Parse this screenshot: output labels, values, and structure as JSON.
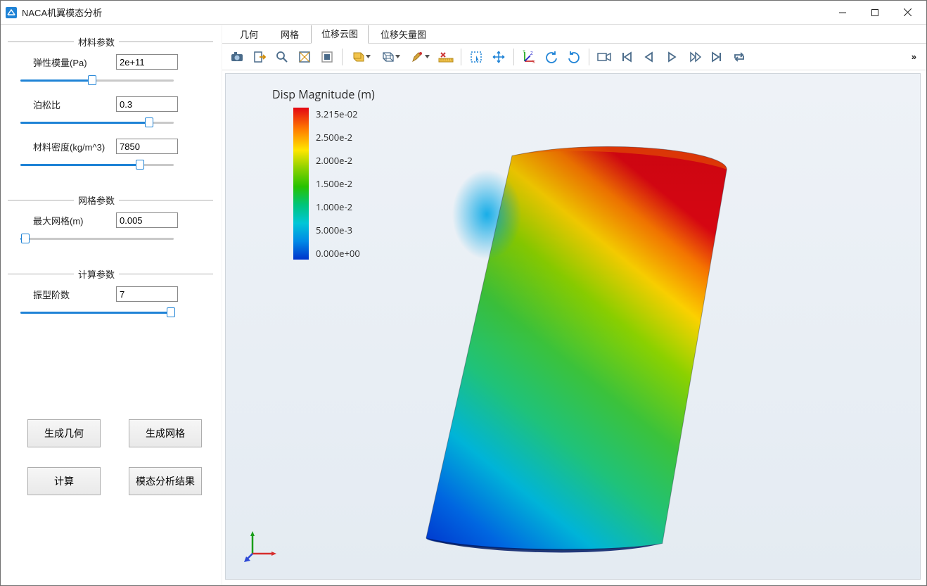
{
  "window": {
    "title": "NACA机翼模态分析"
  },
  "sidebar": {
    "groups": {
      "material": {
        "legend": "材料参数",
        "elastic": {
          "label": "弹性模量(Pa)",
          "value": "2e+11",
          "slider_pct": 47
        },
        "poisson": {
          "label": "泊松比",
          "value": "0.3",
          "slider_pct": 84
        },
        "density": {
          "label": "材料密度(kg/m^3)",
          "value": "7850",
          "slider_pct": 78
        }
      },
      "mesh": {
        "legend": "网格参数",
        "maxmesh": {
          "label": "最大网格(m)",
          "value": "0.005",
          "slider_pct": 3
        }
      },
      "solver": {
        "legend": "计算参数",
        "modes": {
          "label": "振型阶数",
          "value": "7",
          "slider_pct": 98
        }
      }
    },
    "actions": {
      "gen_geometry": "生成几何",
      "gen_mesh": "生成网格",
      "compute": "计算",
      "results": "模态分析结果"
    }
  },
  "tabs": {
    "items": [
      "几何",
      "网格",
      "位移云图",
      "位移矢量图"
    ],
    "active_index": 2
  },
  "toolbar": {
    "icons": [
      "camera-icon",
      "export-icon",
      "zoom-icon",
      "zoom-box-icon",
      "fit-data-icon",
      "boxsel-icon",
      "cube-wire-icon",
      "brush-icon",
      "ruler-icon",
      "marquee-icon",
      "pan-icon",
      "axes-icon",
      "rotate-ccw-icon",
      "rotate-cw-icon",
      "camera-reset-icon",
      "first-icon",
      "prev-icon",
      "play-icon",
      "next-icon",
      "last-icon",
      "loop-icon"
    ],
    "overflow": "»"
  },
  "viewport": {
    "legend_title": "Disp Magnitude (m)",
    "ticks": [
      "3.215e-02",
      "2.500e-2",
      "2.000e-2",
      "1.500e-2",
      "1.000e-2",
      "5.000e-3",
      "0.000e+00"
    ]
  },
  "chart_data": {
    "type": "heatmap",
    "title": "Disp Magnitude (m)",
    "colormap": "rainbow",
    "range": [
      0.0,
      0.03215
    ],
    "ticks": [
      0.0,
      0.005,
      0.01,
      0.015,
      0.02,
      0.025,
      0.03215
    ],
    "description": "FEM displacement magnitude contour on NACA airfoil section; displacement grows from ~0 at root (bottom, blue) to ~0.032 m at free tip corner (upper-right, red).",
    "approx_field_samples": {
      "root_bottom": 0.0,
      "mid_span": 0.016,
      "tip_leading_edge": 0.025,
      "tip_trailing_edge_corner": 0.032
    }
  }
}
